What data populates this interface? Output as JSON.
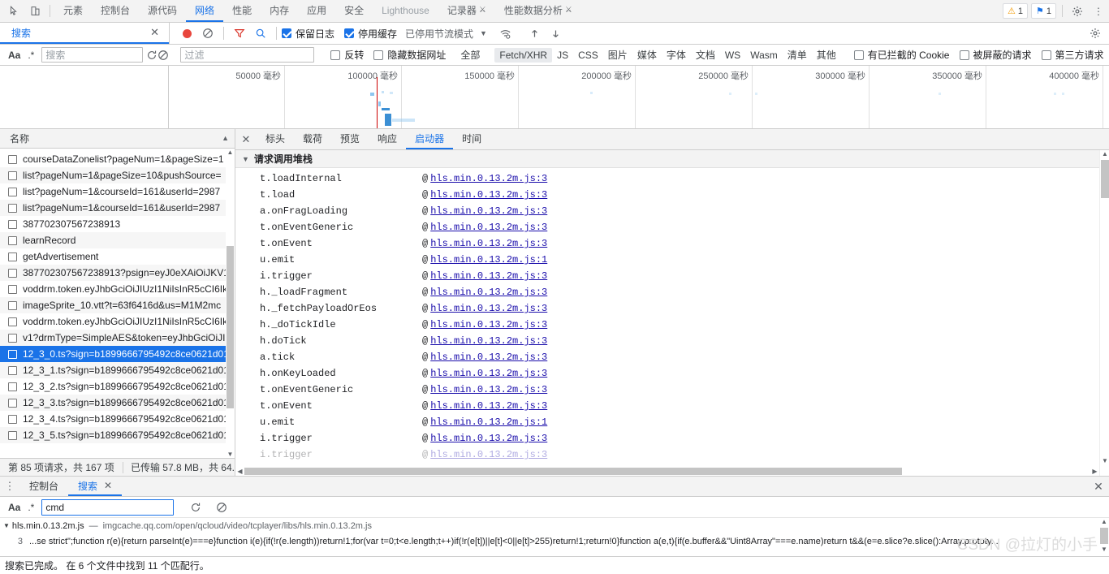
{
  "devtools_tabs": {
    "icons": [
      "inspect-cursor-icon",
      "device-toolbar-icon"
    ],
    "items": [
      {
        "label": "元素",
        "selected": false,
        "muted": false
      },
      {
        "label": "控制台",
        "selected": false,
        "muted": false
      },
      {
        "label": "源代码",
        "selected": false,
        "muted": false
      },
      {
        "label": "网络",
        "selected": true,
        "muted": false
      },
      {
        "label": "性能",
        "selected": false,
        "muted": false
      },
      {
        "label": "内存",
        "selected": false,
        "muted": false
      },
      {
        "label": "应用",
        "selected": false,
        "muted": false
      },
      {
        "label": "安全",
        "selected": false,
        "muted": false
      },
      {
        "label": "Lighthouse",
        "selected": false,
        "muted": true
      },
      {
        "label": "记录器",
        "selected": false,
        "muted": false,
        "flask": true
      },
      {
        "label": "性能数据分析",
        "selected": false,
        "muted": false,
        "flask": true
      }
    ],
    "warning_count": "1",
    "message_count": "1",
    "settings_label": "gear-icon",
    "more_label": "more-vertical-icon"
  },
  "panel_tabstrip": {
    "search_tab": "搜索",
    "close_label": "✕"
  },
  "network_toolbar": {
    "preserve_log": {
      "label": "保留日志",
      "checked": true
    },
    "disable_cache": {
      "label": "停用缓存",
      "checked": true
    },
    "throttling": "已停用节流模式"
  },
  "filterbar": {
    "match_case": "Aa",
    "regex": ".*",
    "search_placeholder": "搜索",
    "search_value": "",
    "filter_placeholder": "过滤",
    "filter_value": "",
    "invert": {
      "label": "反转",
      "checked": false
    },
    "hide_data_urls": {
      "label": "隐藏数据网址",
      "checked": false
    },
    "types": [
      {
        "label": "全部",
        "active": false
      },
      {
        "label": "Fetch/XHR",
        "active": true
      },
      {
        "label": "JS",
        "active": false
      },
      {
        "label": "CSS",
        "active": false
      },
      {
        "label": "图片",
        "active": false
      },
      {
        "label": "媒体",
        "active": false
      },
      {
        "label": "字体",
        "active": false
      },
      {
        "label": "文档",
        "active": false
      },
      {
        "label": "WS",
        "active": false
      },
      {
        "label": "Wasm",
        "active": false
      },
      {
        "label": "清单",
        "active": false
      },
      {
        "label": "其他",
        "active": false
      }
    ],
    "blocked_cookies": {
      "label": "有已拦截的 Cookie",
      "checked": false
    },
    "blocked_requests": {
      "label": "被屏蔽的请求",
      "checked": false
    },
    "third_party": {
      "label": "第三方请求",
      "checked": false
    }
  },
  "overview": {
    "ticks": [
      "50000 毫秒",
      "100000 毫秒",
      "150000 毫秒",
      "200000 毫秒",
      "250000 毫秒",
      "300000 毫秒",
      "350000 毫秒",
      "400000 毫秒"
    ]
  },
  "requests": {
    "column_header": "名称",
    "rows": [
      {
        "name": "courseDataZonelist?pageNum=1&pageSize=1",
        "selected": false
      },
      {
        "name": "list?pageNum=1&pageSize=10&pushSource=",
        "selected": false
      },
      {
        "name": "list?pageNum=1&courseId=161&userId=2987",
        "selected": false
      },
      {
        "name": "list?pageNum=1&courseId=161&userId=2987",
        "selected": false
      },
      {
        "name": "387702307567238913",
        "selected": false
      },
      {
        "name": "learnRecord",
        "selected": false
      },
      {
        "name": "getAdvertisement",
        "selected": false
      },
      {
        "name": "387702307567238913?psign=eyJ0eXAiOiJKV1",
        "selected": false
      },
      {
        "name": "voddrm.token.eyJhbGciOiJIUzI1NiIsInR5cCI6Ik.",
        "selected": false
      },
      {
        "name": "imageSprite_10.vtt?t=63f6416d&us=M1M2mc",
        "selected": false
      },
      {
        "name": "voddrm.token.eyJhbGciOiJIUzI1NiIsInR5cCI6Ik.",
        "selected": false
      },
      {
        "name": "v1?drmType=SimpleAES&token=eyJhbGciOiJI.",
        "selected": false
      },
      {
        "name": "12_3_0.ts?sign=b1899666795492c8ce0621d01",
        "selected": true
      },
      {
        "name": "12_3_1.ts?sign=b1899666795492c8ce0621d01",
        "selected": false
      },
      {
        "name": "12_3_2.ts?sign=b1899666795492c8ce0621d01",
        "selected": false
      },
      {
        "name": "12_3_3.ts?sign=b1899666795492c8ce0621d01",
        "selected": false
      },
      {
        "name": "12_3_4.ts?sign=b1899666795492c8ce0621d01",
        "selected": false
      },
      {
        "name": "12_3_5.ts?sign=b1899666795492c8ce0621d01",
        "selected": false
      }
    ],
    "status_requests": "第 85 项请求，共 167 项",
    "status_transferred": "已传输 57.8 MB，共 64."
  },
  "detail": {
    "tabs": [
      {
        "label": "标头",
        "selected": false
      },
      {
        "label": "载荷",
        "selected": false
      },
      {
        "label": "预览",
        "selected": false
      },
      {
        "label": "响应",
        "selected": false
      },
      {
        "label": "启动器",
        "selected": true
      },
      {
        "label": "时间",
        "selected": false
      }
    ],
    "section_title": "请求调用堆栈",
    "stack": [
      {
        "fn": "t.loadInternal",
        "at": "@",
        "link": "hls.min.0.13.2m.js:3"
      },
      {
        "fn": "t.load",
        "at": "@",
        "link": "hls.min.0.13.2m.js:3"
      },
      {
        "fn": "a.onFragLoading",
        "at": "@",
        "link": "hls.min.0.13.2m.js:3"
      },
      {
        "fn": "t.onEventGeneric",
        "at": "@",
        "link": "hls.min.0.13.2m.js:3"
      },
      {
        "fn": "t.onEvent",
        "at": "@",
        "link": "hls.min.0.13.2m.js:3"
      },
      {
        "fn": "u.emit",
        "at": "@",
        "link": "hls.min.0.13.2m.js:1"
      },
      {
        "fn": "i.trigger",
        "at": "@",
        "link": "hls.min.0.13.2m.js:3"
      },
      {
        "fn": "h._loadFragment",
        "at": "@",
        "link": "hls.min.0.13.2m.js:3"
      },
      {
        "fn": "h._fetchPayloadOrEos",
        "at": "@",
        "link": "hls.min.0.13.2m.js:3"
      },
      {
        "fn": "h._doTickIdle",
        "at": "@",
        "link": "hls.min.0.13.2m.js:3"
      },
      {
        "fn": "h.doTick",
        "at": "@",
        "link": "hls.min.0.13.2m.js:3"
      },
      {
        "fn": "a.tick",
        "at": "@",
        "link": "hls.min.0.13.2m.js:3"
      },
      {
        "fn": "h.onKeyLoaded",
        "at": "@",
        "link": "hls.min.0.13.2m.js:3"
      },
      {
        "fn": "t.onEventGeneric",
        "at": "@",
        "link": "hls.min.0.13.2m.js:3"
      },
      {
        "fn": "t.onEvent",
        "at": "@",
        "link": "hls.min.0.13.2m.js:3"
      },
      {
        "fn": "u.emit",
        "at": "@",
        "link": "hls.min.0.13.2m.js:1"
      },
      {
        "fn": "i.trigger",
        "at": "@",
        "link": "hls.min.0.13.2m.js:3"
      },
      {
        "fn": "i.trigger",
        "at": "@",
        "link": "hls.min.0.13.2m.js:3"
      }
    ]
  },
  "drawer": {
    "tabs": [
      {
        "label": "控制台",
        "selected": false,
        "closable": false
      },
      {
        "label": "搜索",
        "selected": true,
        "closable": true
      }
    ],
    "close_label": "✕",
    "match_case": "Aa",
    "regex": ".*",
    "search_value": "cmd",
    "search_placeholder": "",
    "result_file": "hls.min.0.13.2m.js",
    "result_dash": "—",
    "result_url": "imgcache.qq.com/open/qcloud/video/tcplayer/libs/hls.min.0.13.2m.js",
    "result_line_no": "3",
    "result_code": "...se strict\";function r(e){return parseInt(e)===e}function i(e){if(!r(e.length))return!1;for(var t=0;t<e.length;t++)if(!r(e[t])||e[t]<0||e[t]>255)return!1;return!0}function a(e,t){if(e.buffer&&\"Uint8Array\"===e.name)return t&&(e=e.slice?e.slice():Array.prototy...",
    "status": "搜索已完成。 在 6 个文件中找到 11 个匹配行。"
  },
  "watermark": "CSDN @拉灯的小手"
}
